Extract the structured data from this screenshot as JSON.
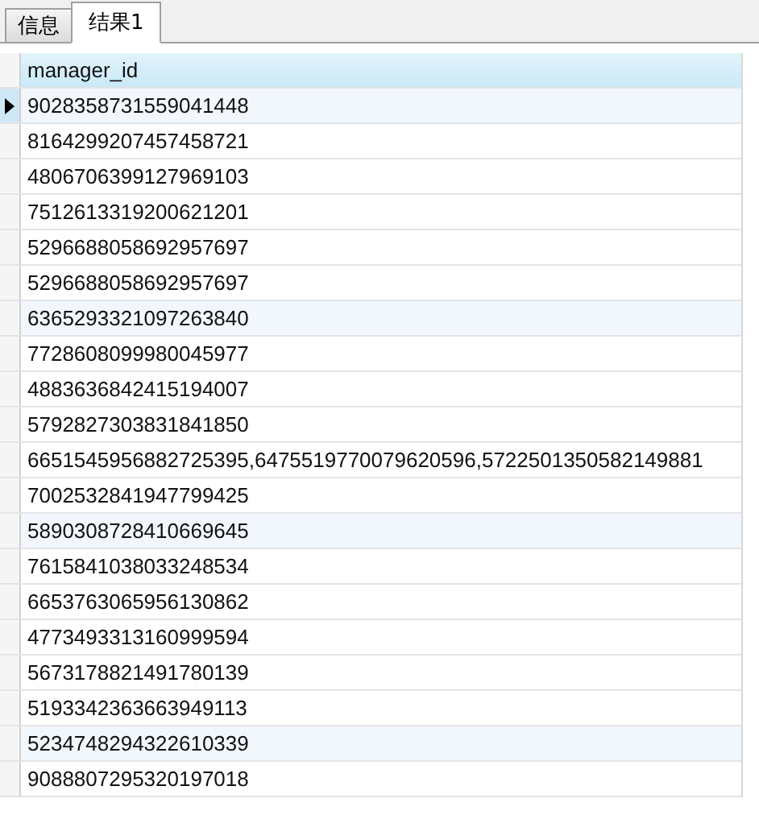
{
  "tabs": [
    {
      "label": "信息",
      "selected": false
    },
    {
      "label": "结果1",
      "selected": true
    }
  ],
  "table": {
    "columns": [
      "manager_id"
    ],
    "rows": [
      {
        "cells": [
          "9028358731559041448"
        ],
        "selected": true
      },
      {
        "cells": [
          "8164299207457458721"
        ],
        "selected": false
      },
      {
        "cells": [
          "4806706399127969103"
        ],
        "selected": false
      },
      {
        "cells": [
          "7512613319200621201"
        ],
        "selected": false
      },
      {
        "cells": [
          "5296688058692957697"
        ],
        "selected": false
      },
      {
        "cells": [
          "5296688058692957697"
        ],
        "selected": false
      },
      {
        "cells": [
          "6365293321097263840"
        ],
        "selected": false
      },
      {
        "cells": [
          "7728608099980045977"
        ],
        "selected": false
      },
      {
        "cells": [
          "4883636842415194007"
        ],
        "selected": false
      },
      {
        "cells": [
          "5792827303831841850"
        ],
        "selected": false
      },
      {
        "cells": [
          "6651545956882725395,6475519770079620596,5722501350582149881"
        ],
        "selected": false
      },
      {
        "cells": [
          "7002532841947799425"
        ],
        "selected": false
      },
      {
        "cells": [
          "5890308728410669645"
        ],
        "selected": false
      },
      {
        "cells": [
          "7615841038033248534"
        ],
        "selected": false
      },
      {
        "cells": [
          "6653763065956130862"
        ],
        "selected": false
      },
      {
        "cells": [
          "4773493313160999594"
        ],
        "selected": false
      },
      {
        "cells": [
          "5673178821491780139"
        ],
        "selected": false
      },
      {
        "cells": [
          "5193342363663949113"
        ],
        "selected": false
      },
      {
        "cells": [
          "5234748294322610339"
        ],
        "selected": false
      },
      {
        "cells": [
          "9088807295320197018"
        ],
        "selected": false
      }
    ]
  }
}
